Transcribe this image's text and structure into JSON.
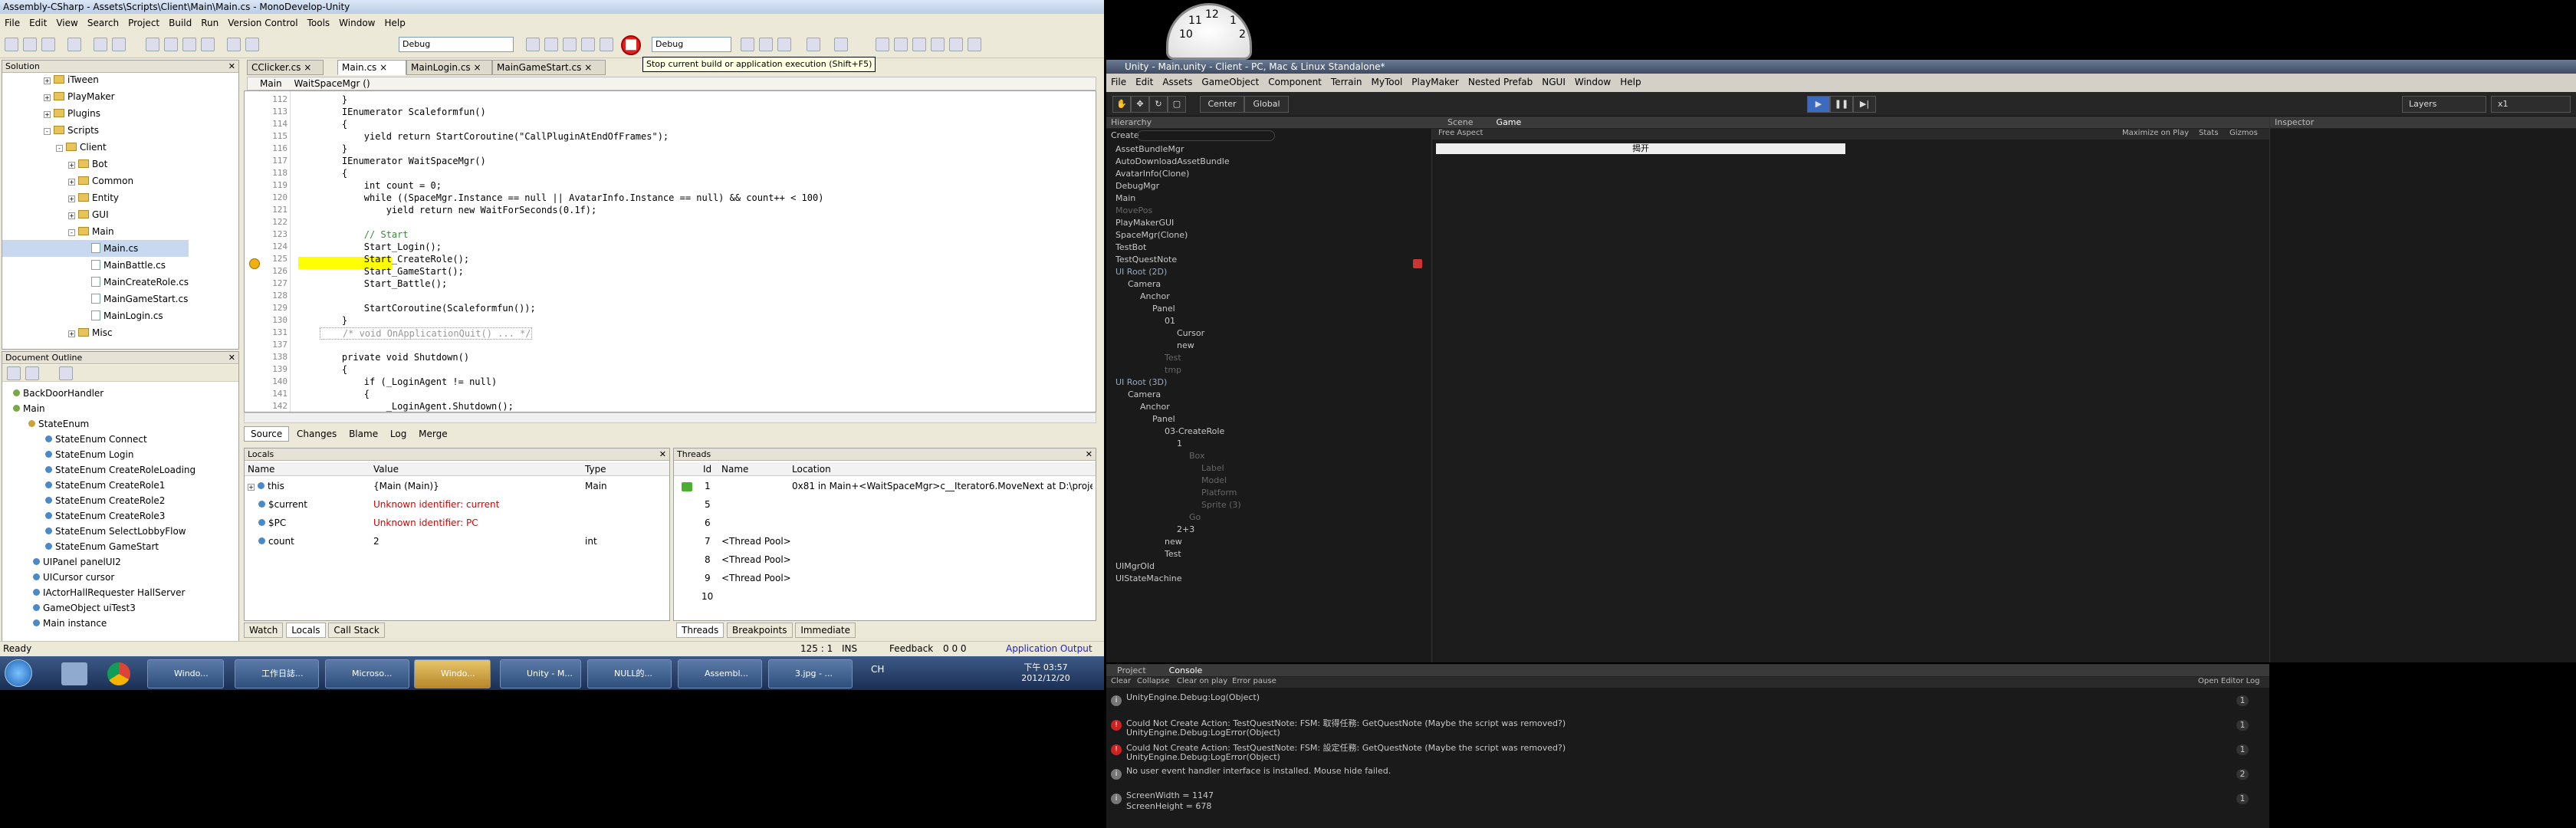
{
  "monodevelop": {
    "title": "Assembly-CSharp - Assets\\Scripts\\Client\\Main\\Main.cs - MonoDevelop-Unity",
    "menu": [
      "File",
      "Edit",
      "View",
      "Search",
      "Project",
      "Build",
      "Run",
      "Version Control",
      "Tools",
      "Window",
      "Help"
    ],
    "config_combo": "Debug",
    "target_combo": "Debug",
    "tooltip": "Stop current build or application execution (Shift+F5)",
    "solution_header": "Solution",
    "solution_tree": [
      "iTween",
      "PlayMaker",
      "Plugins",
      "Scripts",
      "Client",
      "Bot",
      "Common",
      "Entity",
      "GUI",
      "Main",
      "Main.cs",
      "MainBattle.cs",
      "MainCreateRole.cs",
      "MainGameStart.cs",
      "MainLogin.cs",
      "Misc"
    ],
    "outline_header": "Document Outline",
    "outline_items": [
      "BackDoorHandler",
      "Main",
      "StateEnum",
      "StateEnum Connect",
      "StateEnum Login",
      "StateEnum CreateRoleLoading",
      "StateEnum CreateRole1",
      "StateEnum CreateRole2",
      "StateEnum CreateRole3",
      "StateEnum SelectLobbyFlow",
      "StateEnum GameStart",
      "UIPanel panelUI2",
      "UICursor cursor",
      "IActorHallRequester HallServer",
      "GameObject uiTest3",
      "Main instance"
    ],
    "tabs": [
      "CClicker.cs",
      "Main.cs",
      "MainLogin.cs",
      "MainGameStart.cs"
    ],
    "breadcrumb_class": "Main",
    "breadcrumb_method": "WaitSpaceMgr ()",
    "line_numbers": [
      "112",
      "113",
      "114",
      "115",
      "116",
      "117",
      "118",
      "119",
      "120",
      "121",
      "122",
      "123",
      "124",
      "125",
      "126",
      "127",
      "128",
      "129",
      "130",
      "131",
      "137",
      "138",
      "139",
      "140",
      "141",
      "142"
    ],
    "code_lines": [
      "    }",
      "    IEnumerator Scaleformfun()",
      "    {",
      "        yield return StartCoroutine(\"CallPluginAtEndOfFrames\");",
      "    }",
      "    IEnumerator WaitSpaceMgr()",
      "    {",
      "        int count = 0;",
      "        while ((SpaceMgr.Instance == null || AvatarInfo.Instance == null) && count++ < 100)",
      "            yield return new WaitForSeconds(0.1f);",
      "",
      "        // Start",
      "        Start_Login();",
      "        Start_CreateRole();",
      "        Start_GameStart();",
      "        Start_Battle();",
      "",
      "        StartCoroutine(Scaleformfun());",
      "    }",
      "    /* void OnApplicationQuit() ... */",
      "",
      "    private void Shutdown()",
      "    {",
      "        if (_LoginAgent != null)",
      "        {",
      "            _LoginAgent.Shutdown();"
    ],
    "editor_tabs": [
      "Source",
      "Changes",
      "Blame",
      "Log",
      "Merge"
    ],
    "locals_header": "Locals",
    "locals_columns": [
      "Name",
      "Value",
      "Type"
    ],
    "locals_rows": [
      {
        "name": "this",
        "value": "{Main (Main)}",
        "type": "Main"
      },
      {
        "name": "$current",
        "value": "Unknown identifier: current",
        "type": ""
      },
      {
        "name": "$PC",
        "value": "Unknown identifier: PC",
        "type": ""
      },
      {
        "name": "count",
        "value": "2",
        "type": "int"
      }
    ],
    "threads_header": "Threads",
    "threads_columns": [
      "Id",
      "Name",
      "Location"
    ],
    "threads_rows": [
      {
        "id": "1",
        "name": "",
        "location": "0x81 in Main+<WaitSpaceMgr>c__Iterator6.MoveNext at D:\\proje"
      },
      {
        "id": "5",
        "name": "",
        "location": ""
      },
      {
        "id": "6",
        "name": "",
        "location": ""
      },
      {
        "id": "7",
        "name": "<Thread Pool>",
        "location": ""
      },
      {
        "id": "8",
        "name": "<Thread Pool>",
        "location": ""
      },
      {
        "id": "9",
        "name": "<Thread Pool>",
        "location": ""
      },
      {
        "id": "10",
        "name": "",
        "location": ""
      }
    ],
    "bottom_tabs_left": [
      "Watch",
      "Locals",
      "Call Stack"
    ],
    "bottom_tabs_right": [
      "Threads",
      "Breakpoints",
      "Immediate"
    ],
    "status_ready": "Ready",
    "status_pos": "125 : 1",
    "status_ins": "INS",
    "status_feedback": "Feedback",
    "status_counts": "0   0   0",
    "status_output": "Application Output"
  },
  "taskbar": {
    "items": [
      "Windo...",
      "工作日誌...",
      "Microso...",
      "Windo...",
      "Unity - M...",
      "NULL的...",
      "Assembl...",
      "3.jpg - ..."
    ],
    "lang": "CH",
    "time": "下午 03:57",
    "date": "2012/12/20"
  },
  "unity": {
    "title": "Unity - Main.unity - Client - PC, Mac & Linux Standalone*",
    "menu": [
      "File",
      "Edit",
      "Assets",
      "GameObject",
      "Component",
      "Terrain",
      "MyTool",
      "PlayMaker",
      "Nested Prefab",
      "NGUI",
      "Window",
      "Help"
    ],
    "pivot_buttons": [
      "Center",
      "Global"
    ],
    "layers": "Layers",
    "layout": "x1",
    "hierarchy_tab": "Hierarchy",
    "hierarchy_create": "Create",
    "hierarchy_items": [
      "AssetBundleMgr",
      "AutoDownloadAssetBundle",
      "AvatarInfo(Clone)",
      "DebugMgr",
      "Main",
      "MovePos",
      "PlayMakerGUI",
      "SpaceMgr(Clone)",
      "TestBot",
      "TestQuestNote",
      "UI Root (2D)",
      "Camera",
      "Anchor",
      "Panel",
      "01",
      "Cursor",
      "new",
      "Test",
      "tmp",
      "UI Root (3D)",
      "Camera",
      "Anchor",
      "Panel",
      "03-CreateRole",
      "1",
      "Box",
      "Label",
      "Model",
      "Platform",
      "Sprite (3)",
      "Go",
      "2+3",
      "new",
      "Test",
      "UIMgrOld",
      "UIStateMachine"
    ],
    "scene_tab": "Scene",
    "game_tab": "Game",
    "game_aspect": "Free Aspect",
    "game_options": [
      "Maximize on Play",
      "Stats",
      "Gizmos"
    ],
    "game_banner": "揭开",
    "inspector_tab": "Inspector",
    "project_tab": "Project",
    "console_tab": "Console",
    "console_buttons": [
      "Clear",
      "Collapse",
      "Clear on play",
      "Error pause"
    ],
    "console_right": "Open Editor Log",
    "console_entries": [
      {
        "line1": "UnityEngine.Debug:Log(Object)",
        "line2": "",
        "kind": "info",
        "count": "1"
      },
      {
        "line1": "Could Not Create Action: TestQuestNote: FSM: 取得任務: GetQuestNote (Maybe the script was removed?)",
        "line2": "UnityEngine.Debug:LogError(Object)",
        "kind": "error",
        "count": "1"
      },
      {
        "line1": "Could Not Create Action: TestQuestNote: FSM: 設定任務: GetQuestNote (Maybe the script was removed?)",
        "line2": "UnityEngine.Debug:LogError(Object)",
        "kind": "error",
        "count": "1"
      },
      {
        "line1": "No user event handler interface is installed. Mouse hide failed.",
        "line2": "",
        "kind": "info",
        "count": "2"
      },
      {
        "line1": "ScreenWidth = 1147",
        "line2": "ScreenHeight = 678",
        "kind": "info",
        "count": "1"
      }
    ]
  },
  "clock": {
    "numerals": [
      "10",
      "11",
      "12",
      "1",
      "2"
    ]
  },
  "colors": {
    "accent": "#316ac5",
    "highlight_line": "#ffff00",
    "error_red": "#d00000",
    "unity_bg": "#1e1e1e"
  }
}
